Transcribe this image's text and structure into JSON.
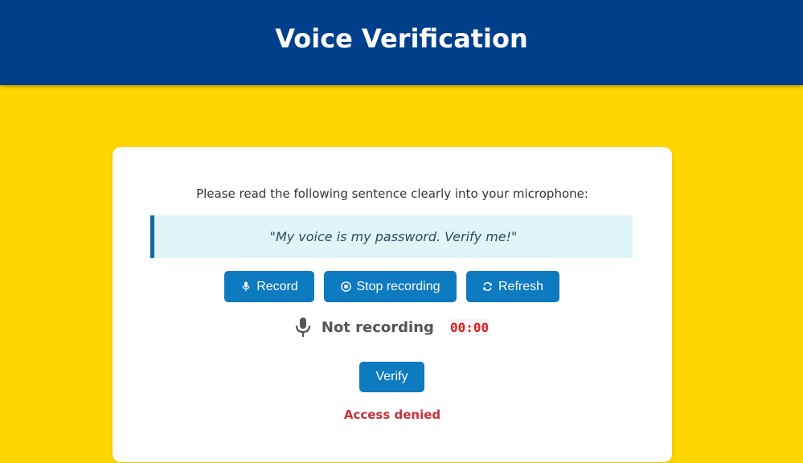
{
  "header": {
    "title": "Voice Verification",
    "background": "#003F8A"
  },
  "page": {
    "background": "#FFD500"
  },
  "card": {
    "instruction": "Please read the following sentence clearly into your microphone:",
    "sentence": "\"My voice is my password. Verify me!\"",
    "buttons": {
      "record": {
        "label": "Record",
        "icon": "microphone-icon"
      },
      "stop": {
        "label": "Stop recording",
        "icon": "stop-circle-icon"
      },
      "refresh": {
        "label": "Refresh",
        "icon": "refresh-icon"
      }
    },
    "status": {
      "icon": "microphone-icon",
      "text": "Not recording",
      "timer": "00:00"
    },
    "verify_label": "Verify",
    "result": "Access denied"
  },
  "colors": {
    "button": "#0E7AC0",
    "error": "#C8313A",
    "timer": "#E02020"
  }
}
